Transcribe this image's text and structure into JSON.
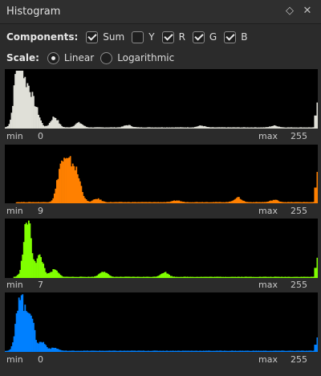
{
  "window": {
    "title": "Histogram"
  },
  "components": {
    "label": "Components:",
    "items": [
      {
        "label": "Sum",
        "checked": true
      },
      {
        "label": "Y",
        "checked": false
      },
      {
        "label": "R",
        "checked": true
      },
      {
        "label": "G",
        "checked": true
      },
      {
        "label": "B",
        "checked": true
      }
    ]
  },
  "scale": {
    "label": "Scale:",
    "options": [
      {
        "label": "Linear",
        "selected": true
      },
      {
        "label": "Logarithmic",
        "selected": false
      }
    ]
  },
  "histograms": [
    {
      "name": "sum",
      "color": "#e0e0d8",
      "min_label": "min",
      "min_value": "0",
      "max_label": "max",
      "max_value": "255"
    },
    {
      "name": "red",
      "color": "#ff8000",
      "min_label": "min",
      "min_value": "9",
      "max_label": "max",
      "max_value": "255"
    },
    {
      "name": "green",
      "color": "#80ff00",
      "min_label": "min",
      "min_value": "7",
      "max_label": "max",
      "max_value": "255"
    },
    {
      "name": "blue",
      "color": "#0080ff",
      "min_label": "min",
      "min_value": "0",
      "max_label": "max",
      "max_value": "255"
    }
  ],
  "chart_data": [
    {
      "type": "area",
      "series": [
        {
          "name": "Sum",
          "peaks": [
            [
              10,
              0.95
            ],
            [
              13,
              0.55
            ],
            [
              19,
              0.6
            ],
            [
              25,
              0.28
            ],
            [
              40,
              0.18
            ],
            [
              60,
              0.08
            ],
            [
              100,
              0.04
            ],
            [
              160,
              0.03
            ],
            [
              220,
              0.03
            ]
          ],
          "x_range": [
            0,
            255
          ],
          "end_spike": 0.45
        }
      ]
    },
    {
      "type": "area",
      "series": [
        {
          "name": "R",
          "peaks": [
            [
              45,
              0.55
            ],
            [
              50,
              0.45
            ],
            [
              55,
              0.5
            ],
            [
              60,
              0.3
            ],
            [
              75,
              0.06
            ],
            [
              140,
              0.03
            ],
            [
              190,
              0.08
            ],
            [
              220,
              0.04
            ]
          ],
          "x_range": [
            9,
            255
          ],
          "end_spike": 0.55
        }
      ]
    },
    {
      "type": "area",
      "series": [
        {
          "name": "G",
          "peaks": [
            [
              18,
              1.0
            ],
            [
              28,
              0.35
            ],
            [
              40,
              0.12
            ],
            [
              80,
              0.1
            ],
            [
              130,
              0.08
            ]
          ],
          "x_range": [
            7,
            255
          ],
          "end_spike": 0.35
        }
      ]
    },
    {
      "type": "area",
      "series": [
        {
          "name": "B",
          "peaks": [
            [
              12,
              1.0
            ],
            [
              20,
              0.7
            ],
            [
              30,
              0.15
            ],
            [
              40,
              0.05
            ]
          ],
          "x_range": [
            0,
            255
          ],
          "end_spike": 0.25
        }
      ]
    }
  ]
}
